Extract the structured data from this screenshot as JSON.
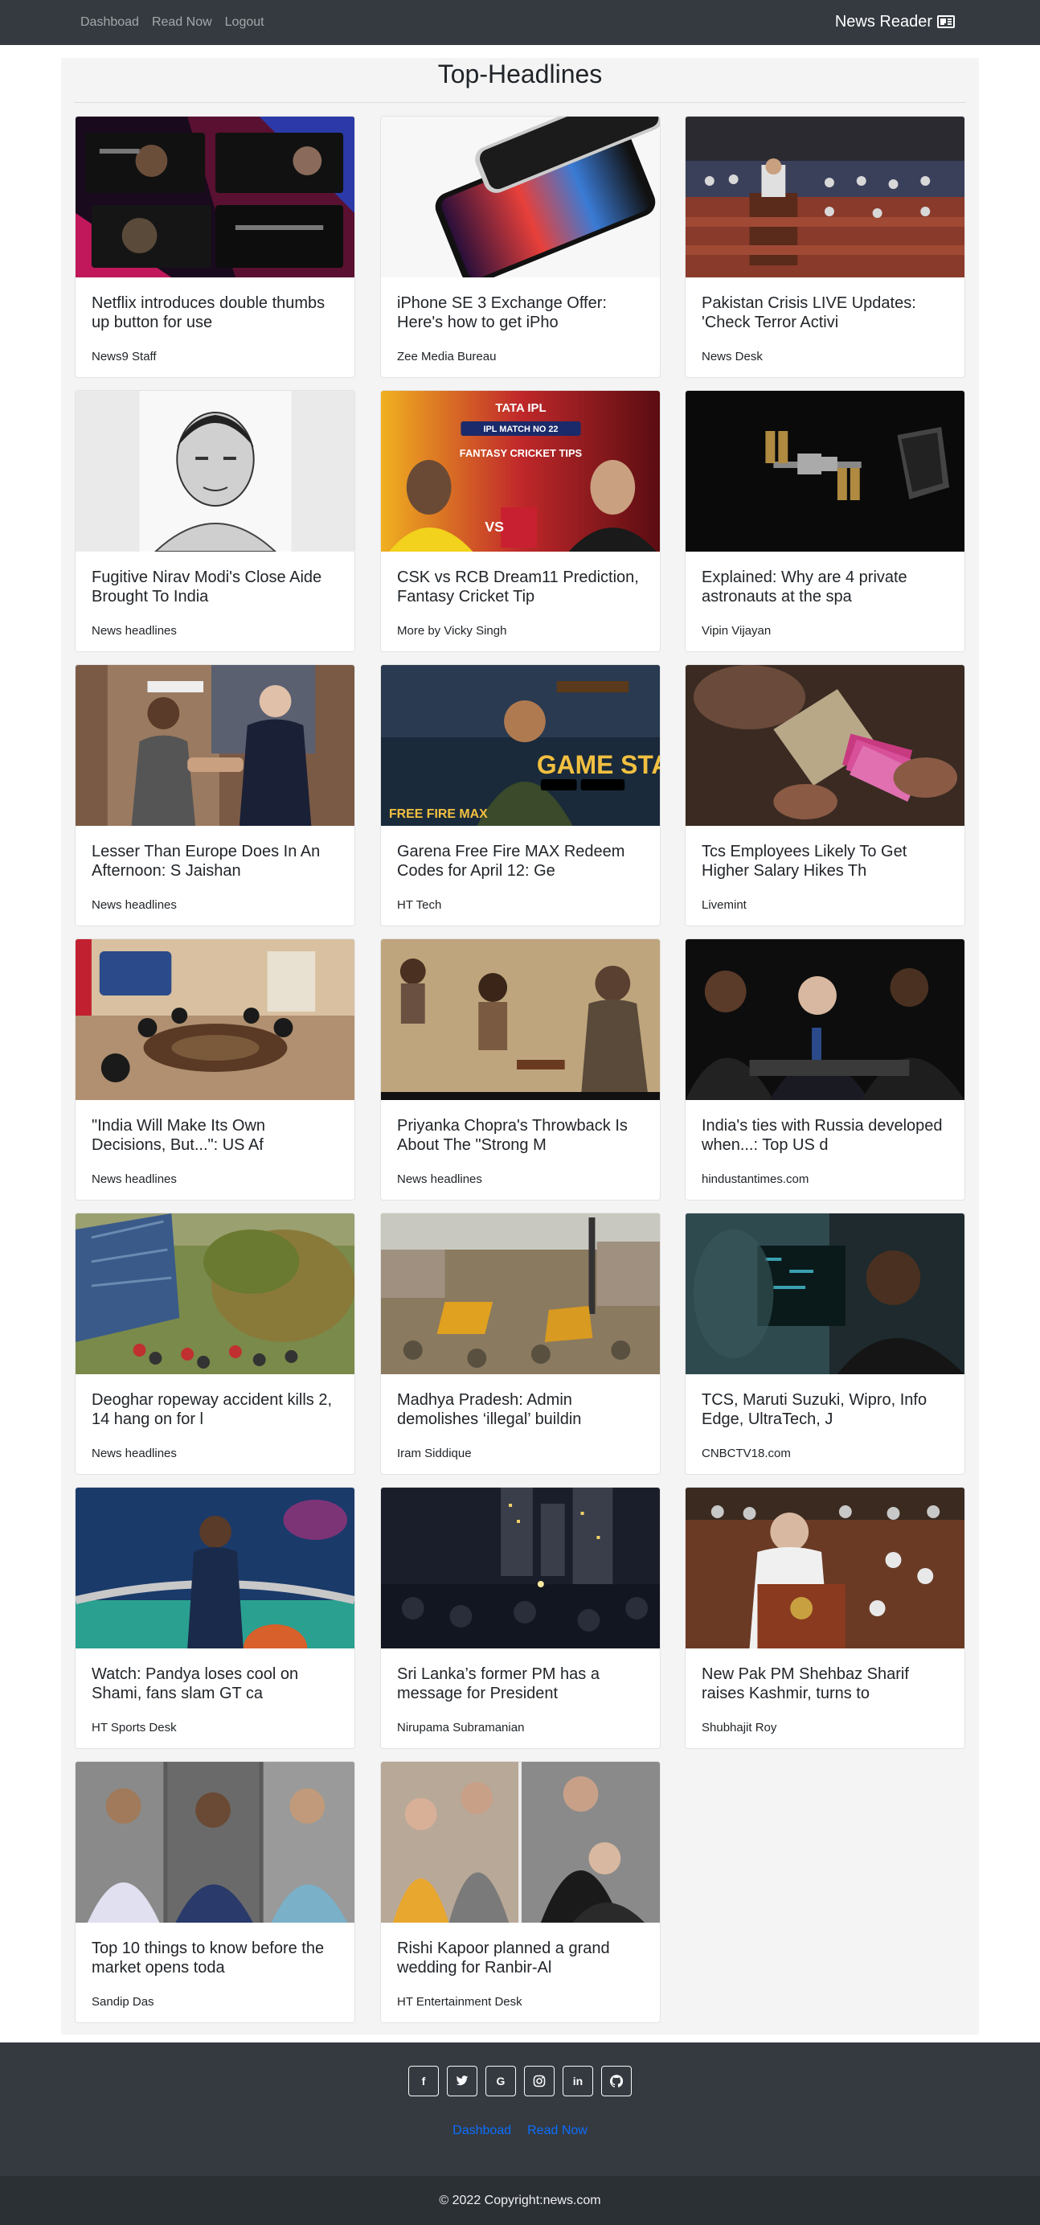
{
  "nav": {
    "links": [
      "Dashboad",
      "Read Now",
      "Logout"
    ],
    "brand": "News Reader"
  },
  "main": {
    "title": "Top-Headlines",
    "articles": [
      {
        "title": "Netflix introduces double thumbs up button for use",
        "source": "News9 Staff"
      },
      {
        "title": "iPhone SE 3 Exchange Offer: Here's how to get iPho",
        "source": "Zee Media Bureau"
      },
      {
        "title": "Pakistan Crisis LIVE Updates: 'Check Terror Activi",
        "source": "News Desk"
      },
      {
        "title": "Fugitive Nirav Modi's Close Aide Brought To India",
        "source": "News headlines"
      },
      {
        "title": "CSK vs RCB Dream11 Prediction, Fantasy Cricket Tip",
        "source": "More by Vicky Singh"
      },
      {
        "title": "Explained: Why are 4 private astronauts at the spa",
        "source": "Vipin Vijayan"
      },
      {
        "title": "Lesser Than Europe Does In An Afternoon: S Jaishan",
        "source": "News headlines"
      },
      {
        "title": "Garena Free Fire MAX Redeem Codes for April 12: Ge",
        "source": "HT Tech"
      },
      {
        "title": "Tcs Employees Likely To Get Higher Salary Hikes Th",
        "source": "Livemint"
      },
      {
        "title": "\"India Will Make Its Own Decisions, But...\": US Af",
        "source": "News headlines"
      },
      {
        "title": "Priyanka Chopra's Throwback Is About The \"Strong M",
        "source": "News headlines"
      },
      {
        "title": "India's ties with Russia developed when...: Top US d",
        "source": "hindustantimes.com"
      },
      {
        "title": "Deoghar ropeway accident kills 2, 14 hang on for l",
        "source": "News headlines"
      },
      {
        "title": "Madhya Pradesh: Admin demolishes ‘illegal’ buildin",
        "source": "Iram Siddique"
      },
      {
        "title": "TCS, Maruti Suzuki, Wipro, Info Edge, UltraTech, J",
        "source": "CNBCTV18.com"
      },
      {
        "title": "Watch: Pandya loses cool on Shami, fans slam GT ca",
        "source": "HT Sports Desk"
      },
      {
        "title": "Sri Lanka’s former PM has a message for President",
        "source": "Nirupama Subramanian"
      },
      {
        "title": "New Pak PM Shehbaz Sharif raises Kashmir, turns to",
        "source": "Shubhajit Roy"
      },
      {
        "title": "Top 10 things to know before the market opens toda",
        "source": "Sandip Das"
      },
      {
        "title": "Rishi Kapoor planned a grand wedding for Ranbir-Al",
        "source": "HT Entertainment Desk"
      }
    ],
    "image_overlays": {
      "ipl_top": "TATA IPL",
      "ipl_match": "IPL MATCH NO 22",
      "ipl_tips": "FANTASY CRICKET TIPS",
      "ff_start": "GAME START",
      "ff_brand": "FREE FIRE MAX"
    }
  },
  "footer": {
    "social": [
      {
        "icon": "facebook-icon",
        "glyph": "f"
      },
      {
        "icon": "twitter-icon",
        "glyph": "t"
      },
      {
        "icon": "google-icon",
        "glyph": "G"
      },
      {
        "icon": "instagram-icon",
        "glyph": "◎"
      },
      {
        "icon": "linkedin-icon",
        "glyph": "in"
      },
      {
        "icon": "github-icon",
        "glyph": "○"
      }
    ],
    "links": [
      "Dashboad",
      "Read Now"
    ],
    "copyright": "© 2022 Copyright:news.com"
  },
  "colors": {
    "navbar": "#343a40",
    "link_muted": "rgba(255,255,255,0.55)",
    "accent_link": "#0d6efd",
    "container_bg": "#f4f4f4"
  }
}
